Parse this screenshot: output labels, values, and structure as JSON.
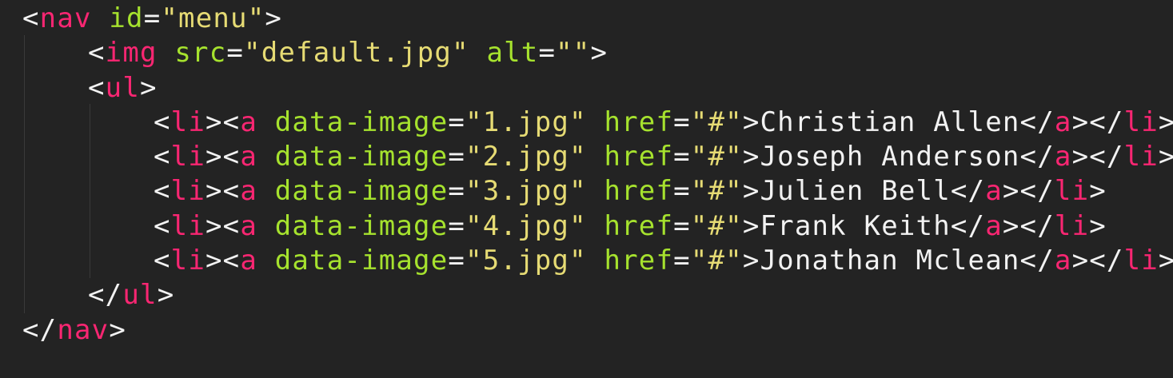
{
  "code": {
    "lines": [
      {
        "tag": "nav",
        "attr": "id",
        "value": "\"menu\""
      },
      {
        "tag": "img",
        "attr1": "src",
        "value1": "\"default.jpg\"",
        "attr2": "alt",
        "value2": "\"\""
      },
      {
        "tag": "ul"
      },
      {
        "tag_li": "li",
        "tag_a": "a",
        "attr1": "data-image",
        "value1": "\"1.jpg\"",
        "attr2": "href",
        "value2": "\"#\"",
        "text": "Christian Allen"
      },
      {
        "tag_li": "li",
        "tag_a": "a",
        "attr1": "data-image",
        "value1": "\"2.jpg\"",
        "attr2": "href",
        "value2": "\"#\"",
        "text": "Joseph Anderson"
      },
      {
        "tag_li": "li",
        "tag_a": "a",
        "attr1": "data-image",
        "value1": "\"3.jpg\"",
        "attr2": "href",
        "value2": "\"#\"",
        "text": "Julien Bell"
      },
      {
        "tag_li": "li",
        "tag_a": "a",
        "attr1": "data-image",
        "value1": "\"4.jpg\"",
        "attr2": "href",
        "value2": "\"#\"",
        "text": "Frank Keith"
      },
      {
        "tag_li": "li",
        "tag_a": "a",
        "attr1": "data-image",
        "value1": "\"5.jpg\"",
        "attr2": "href",
        "value2": "\"#\"",
        "text": "Jonathan Mclean"
      },
      {
        "tag": "ul"
      },
      {
        "tag": "nav"
      }
    ]
  },
  "colors": {
    "background": "#232323",
    "punctuation": "#f2f2f2",
    "tag": "#f92672",
    "attribute": "#a6e22e",
    "string": "#e6db74"
  }
}
